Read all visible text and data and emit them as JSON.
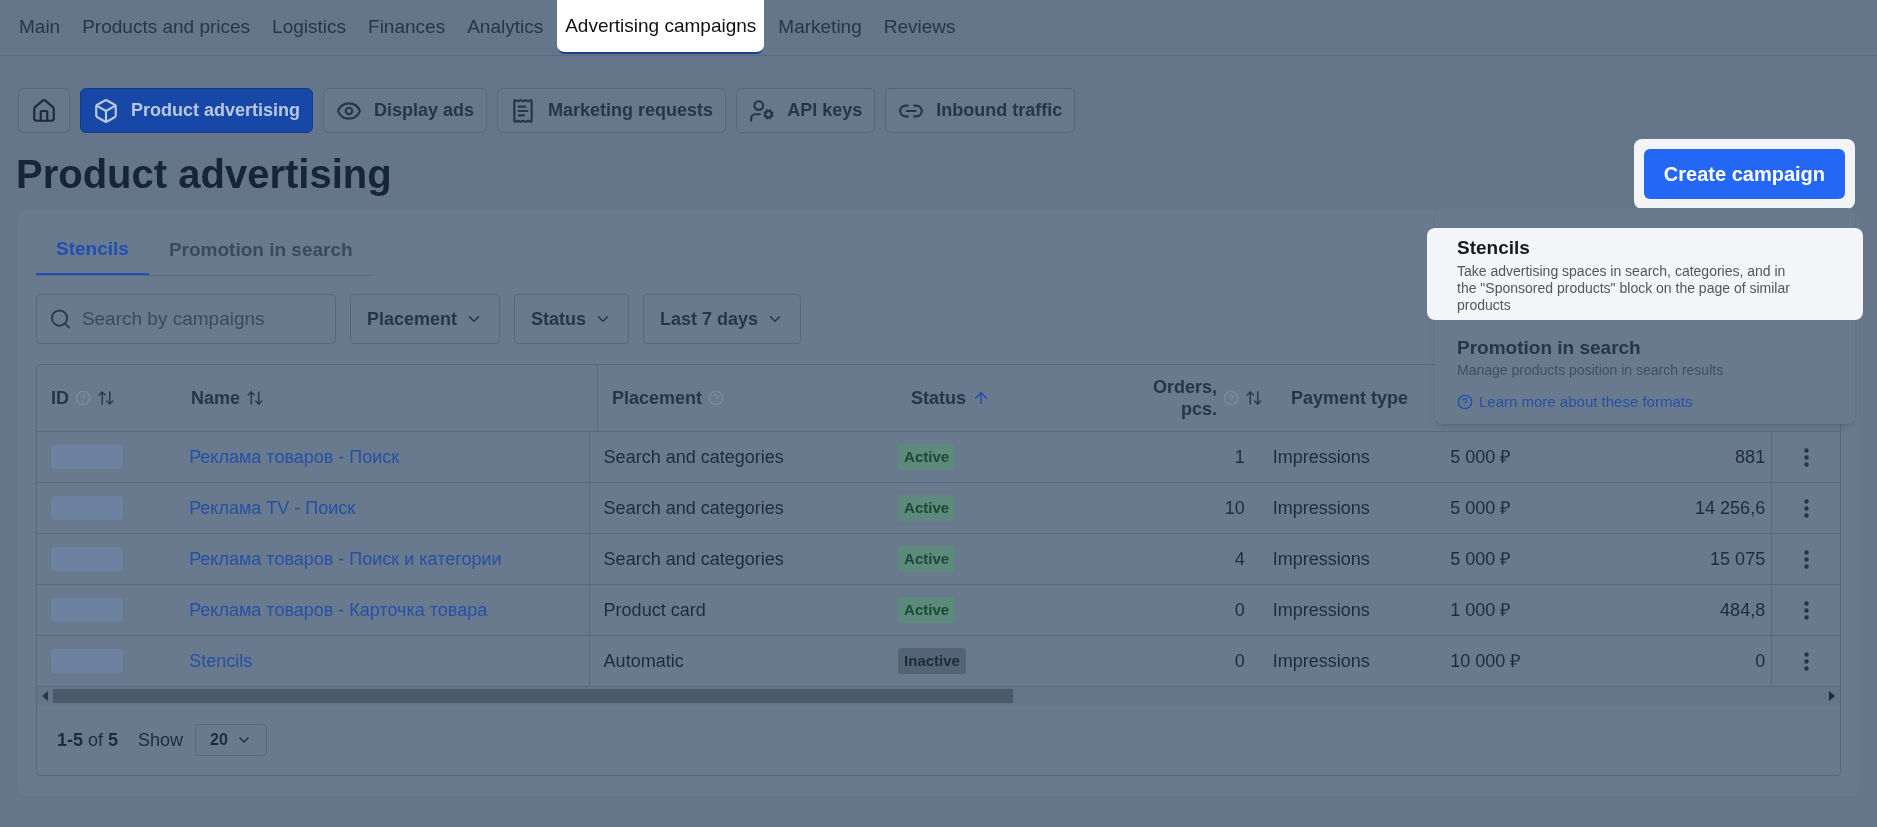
{
  "top_nav": [
    {
      "label": "Main",
      "selected": false
    },
    {
      "label": "Products and prices",
      "selected": false
    },
    {
      "label": "Logistics",
      "selected": false
    },
    {
      "label": "Finances",
      "selected": false
    },
    {
      "label": "Analytics",
      "selected": false
    },
    {
      "label": "Advertising campaigns",
      "selected": true
    },
    {
      "label": "Marketing",
      "selected": false
    },
    {
      "label": "Reviews",
      "selected": false
    }
  ],
  "sub_nav": [
    {
      "label": "Product advertising",
      "selected": true
    },
    {
      "label": "Display ads",
      "selected": false
    },
    {
      "label": "Marketing requests",
      "selected": false
    },
    {
      "label": "API keys",
      "selected": false
    },
    {
      "label": "Inbound traffic",
      "selected": false
    }
  ],
  "page_title": "Product advertising",
  "create_button": "Create campaign",
  "create_menu": {
    "options": [
      {
        "title": "Stencils",
        "description": "Take advertising spaces in search, categories, and in the \"Sponsored products\" block on the page of similar products",
        "selected": true
      },
      {
        "title": "Promotion in search",
        "description": "Manage products position in search results",
        "selected": false
      }
    ],
    "link": "Learn more about these formats"
  },
  "tabs": [
    {
      "label": "Stencils",
      "selected": true
    },
    {
      "label": "Promotion in search",
      "selected": false
    }
  ],
  "search": {
    "placeholder": "Search by campaigns"
  },
  "filters": [
    "Placement",
    "Status",
    "Last 7 days"
  ],
  "table": {
    "columns": [
      {
        "label": "ID",
        "help": true,
        "sortable": true,
        "sorted": false
      },
      {
        "label": "Name",
        "help": false,
        "sortable": true,
        "sorted": false
      },
      {
        "label": "Placement",
        "help": true,
        "sortable": false
      },
      {
        "label": "Status",
        "help": false,
        "sortable": true,
        "sorted": true
      },
      {
        "label": "Orders, pcs.",
        "help": true,
        "sortable": true,
        "sorted": false
      },
      {
        "label": "Payment type",
        "help": false,
        "sortable": false
      }
    ],
    "rows": [
      {
        "name": "Реклама товаров - Поиск",
        "placement": "Search and categories",
        "status": {
          "label": "Active",
          "kind": "active"
        },
        "orders": "1",
        "payment": "Impressions",
        "column_7": "5 000 ₽",
        "column_8": "881"
      },
      {
        "name": "Реклама TV - Поиск",
        "placement": "Search and categories",
        "status": {
          "label": "Active",
          "kind": "active"
        },
        "orders": "10",
        "payment": "Impressions",
        "column_7": "5 000 ₽",
        "column_8": "14 256,6"
      },
      {
        "name": "Реклама товаров - Поиск и категории",
        "placement": "Search and categories",
        "status": {
          "label": "Active",
          "kind": "active"
        },
        "orders": "4",
        "payment": "Impressions",
        "column_7": "5 000 ₽",
        "column_8": "15 075"
      },
      {
        "name": "Реклама товаров - Карточка товара",
        "placement": "Product card",
        "status": {
          "label": "Active",
          "kind": "active"
        },
        "orders": "0",
        "payment": "Impressions",
        "column_7": "1 000 ₽",
        "column_8": "484,8"
      },
      {
        "name": "Stencils",
        "placement": "Automatic",
        "status": {
          "label": "Inactive",
          "kind": "inactive"
        },
        "orders": "0",
        "payment": "Impressions",
        "column_7": "10 000 ₽",
        "column_8": "0"
      }
    ]
  },
  "pagination": {
    "range": "**1-5** of **5**",
    "show_label": "Show",
    "page_size": "20"
  }
}
